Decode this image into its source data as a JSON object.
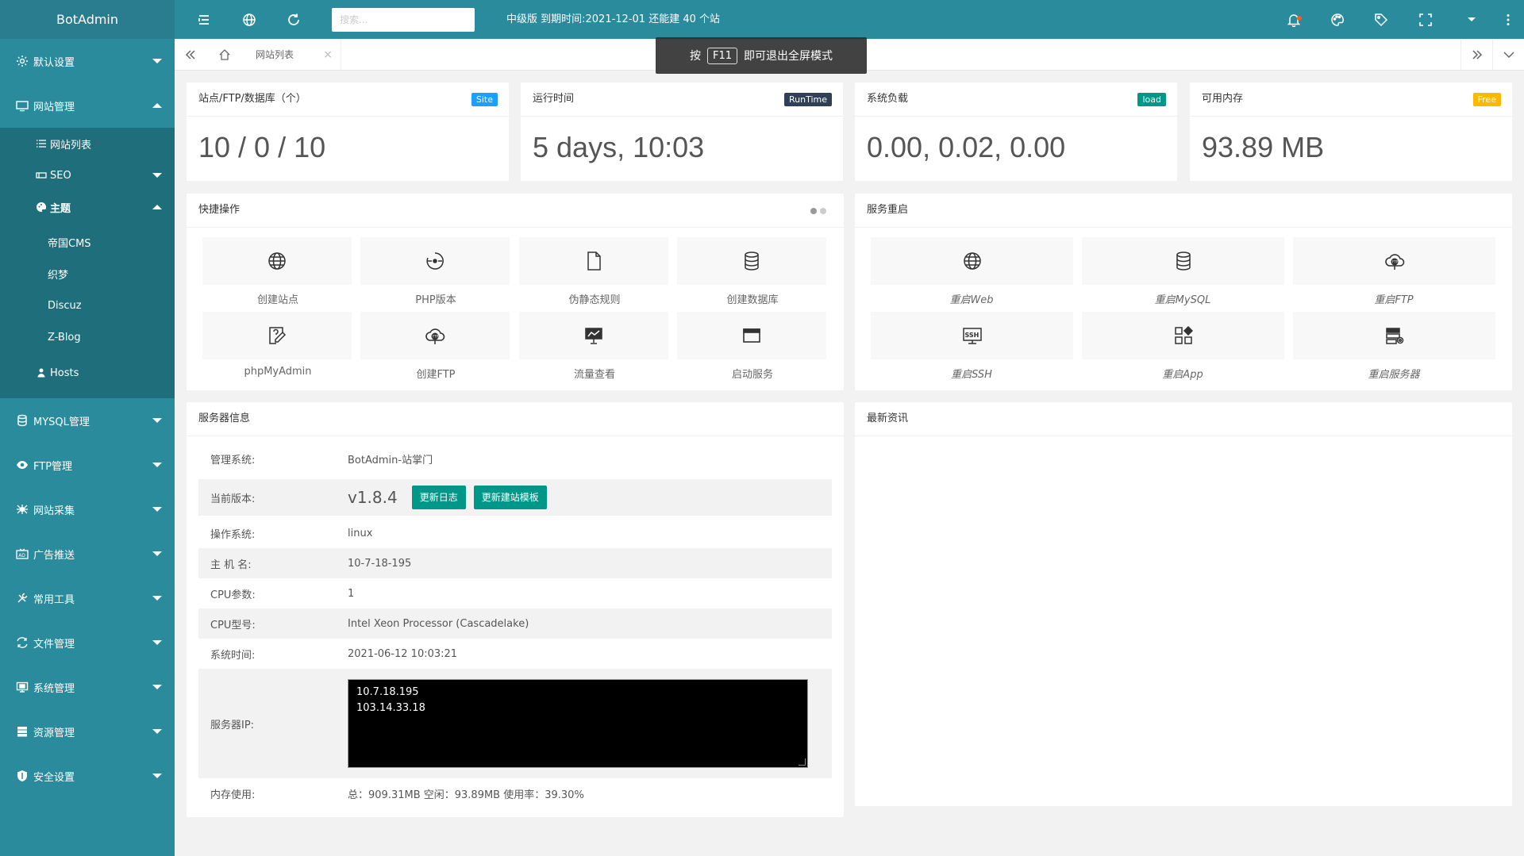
{
  "header": {
    "logo": "BotAdmin",
    "search_placeholder": "搜索...",
    "notice": "中级版 到期时间:2021-12-01 还能建 40 个站"
  },
  "toast": {
    "prefix": "按",
    "key": "F11",
    "suffix": "即可退出全屏模式"
  },
  "tabbar": {
    "tab_label": "网站列表",
    "tab_close": "×"
  },
  "sidebar": {
    "items": [
      {
        "label": "默认设置",
        "icon": "gear-icon"
      },
      {
        "label": "网站管理",
        "icon": "monitor-icon"
      },
      {
        "label": "MYSQL管理",
        "icon": "database-icon"
      },
      {
        "label": "FTP管理",
        "icon": "eye-icon"
      },
      {
        "label": "网站采集",
        "icon": "spider-icon"
      },
      {
        "label": "广告推送",
        "icon": "ad-icon"
      },
      {
        "label": "常用工具",
        "icon": "tools-icon"
      },
      {
        "label": "文件管理",
        "icon": "file-sync-icon"
      },
      {
        "label": "系统管理",
        "icon": "display-icon"
      },
      {
        "label": "资源管理",
        "icon": "server-icon"
      },
      {
        "label": "安全设置",
        "icon": "shield-icon"
      }
    ],
    "sub": {
      "list": "网站列表",
      "seo": "SEO",
      "theme": "主题",
      "themes": [
        "帝国CMS",
        "织梦",
        "Discuz",
        "Z-Blog"
      ],
      "hosts": "Hosts"
    }
  },
  "stats": [
    {
      "title": "站点/FTP/数据库（个）",
      "badge": "Site",
      "badge_color": "#1E9FFF",
      "value": "10 / 0 / 10"
    },
    {
      "title": "运行时间",
      "badge": "RunTime",
      "badge_color": "#2F4056",
      "value": "5 days, 10:03"
    },
    {
      "title": "系统负载",
      "badge": "load",
      "badge_color": "#009688",
      "value": "0.00, 0.02, 0.00"
    },
    {
      "title": "可用内存",
      "badge": "Free",
      "badge_color": "#FFB800",
      "value": "93.89 MB"
    }
  ],
  "quick": {
    "title": "快捷操作",
    "tiles": [
      "创建站点",
      "PHP版本",
      "伪静态规则",
      "创建数据库",
      "phpMyAdmin",
      "创建FTP",
      "流量查看",
      "启动服务"
    ]
  },
  "restart": {
    "title": "服务重启",
    "tiles": [
      "重启Web",
      "重启MySQL",
      "重启FTP",
      "重启SSH",
      "重启App",
      "重启服务器"
    ]
  },
  "server": {
    "title": "服务器信息",
    "os_admin_label": "管理系统:",
    "os_admin_value": "BotAdmin-站掌门",
    "version_label": "当前版本:",
    "version_value": "v1.8.4",
    "btn_changelog": "更新日志",
    "btn_template": "更新建站模板",
    "os_label": "操作系统:",
    "os_value": "linux",
    "host_label": "主 机 名:",
    "host_value": "10-7-18-195",
    "cpu_label": "CPU参数:",
    "cpu_value": "1",
    "cpu_model_label": "CPU型号:",
    "cpu_model_value": "Intel Xeon Processor (Cascadelake)",
    "time_label": "系统时间:",
    "time_value": "2021-06-12 10:03:21",
    "ip_label": "服务器IP:",
    "ip_lines": [
      "10.7.18.195",
      "103.14.33.18"
    ],
    "mem_label": "内存使用:",
    "mem_value": "总：909.31MB 空闲：93.89MB 使用率：39.30%"
  },
  "news": {
    "title": "最新资讯"
  }
}
